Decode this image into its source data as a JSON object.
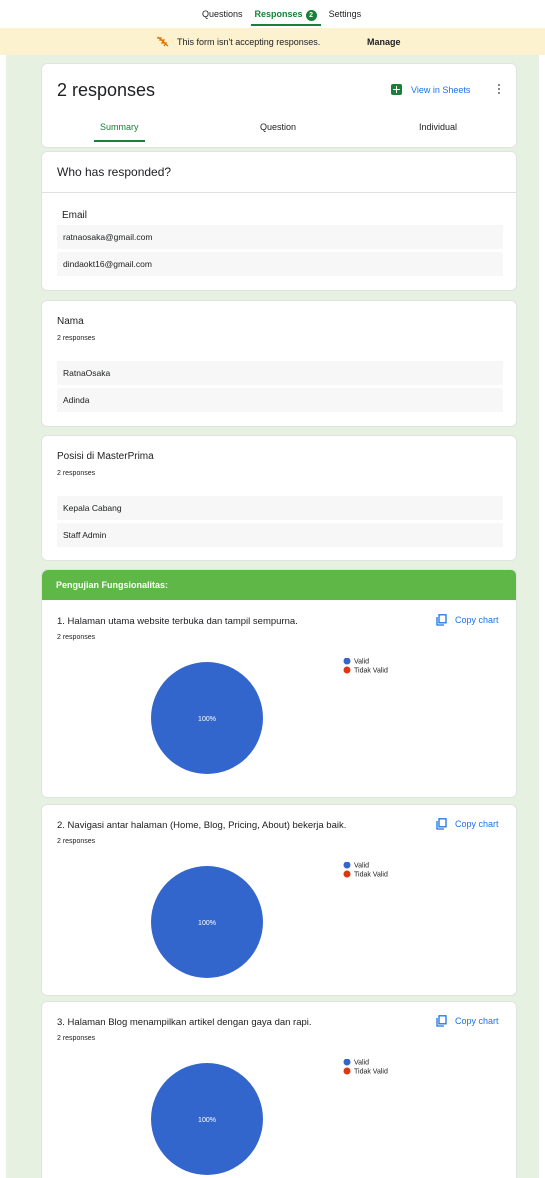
{
  "topnav": {
    "tabs": [
      {
        "label": "Questions"
      },
      {
        "label": "Responses",
        "badge": "2"
      },
      {
        "label": "Settings"
      }
    ]
  },
  "banner": {
    "message": "This form isn't accepting responses.",
    "manage_label": "Manage"
  },
  "header": {
    "title": "2 responses",
    "sheets_label": "View in Sheets",
    "subtabs": [
      "Summary",
      "Question",
      "Individual"
    ],
    "active_subtab": "Summary"
  },
  "who": {
    "title": "Who has responded?",
    "label": "Email",
    "emails": [
      "ratnaosaka@gmail.com",
      "dindaokt16@gmail.com"
    ]
  },
  "nama": {
    "title": "Nama",
    "count": "2 responses",
    "values": [
      "RatnaOsaka",
      "Adinda"
    ]
  },
  "posisi": {
    "title": "Posisi di MasterPrima",
    "count": "2 responses",
    "values": [
      "Kepala Cabang",
      "Staff Admin"
    ]
  },
  "section": {
    "title": "Pengujian Fungsionalitas:"
  },
  "copy_label": "Copy chart",
  "colors": {
    "valid": "#3366cc",
    "tidak_valid": "#dc3912",
    "accent": "#188038",
    "section": "#5fb747"
  },
  "chart_data": [
    {
      "type": "pie",
      "title": "1. Halaman utama website terbuka dan tampil sempurna.",
      "subtitle": "2 responses",
      "categories": [
        "Valid",
        "Tidak Valid"
      ],
      "values": [
        2,
        0
      ],
      "data_labels": [
        "100%"
      ]
    },
    {
      "type": "pie",
      "title": "2. Navigasi antar halaman (Home, Blog, Pricing, About) bekerja baik.",
      "subtitle": "2 responses",
      "categories": [
        "Valid",
        "Tidak Valid"
      ],
      "values": [
        2,
        0
      ],
      "data_labels": [
        "100%"
      ]
    },
    {
      "type": "pie",
      "title": "3. Halaman Blog menampilkan artikel dengan gaya dan rapi.",
      "subtitle": "2 responses",
      "categories": [
        "Valid",
        "Tidak Valid"
      ],
      "values": [
        2,
        0
      ],
      "data_labels": [
        "100%"
      ]
    }
  ]
}
